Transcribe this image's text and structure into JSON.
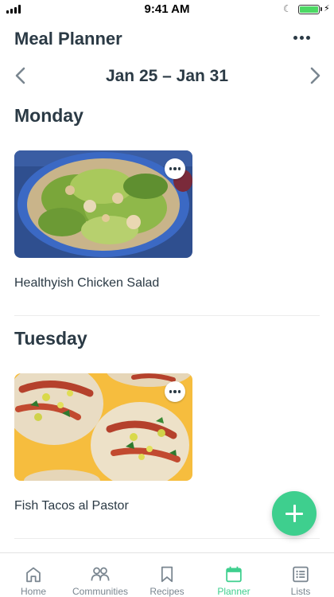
{
  "status_bar": {
    "time": "9:41 AM",
    "battery_level": 1.0
  },
  "header": {
    "title": "Meal Planner",
    "more_icon": "more-horizontal-icon"
  },
  "week": {
    "range": "Jan 25 – Jan 31",
    "prev_icon": "chevron-left-icon",
    "next_icon": "chevron-right-icon"
  },
  "days": [
    {
      "day": "Monday",
      "meal": {
        "title": "Healthyish Chicken Salad",
        "image": "chicken-salad-photo"
      }
    },
    {
      "day": "Tuesday",
      "meal": {
        "title": "Fish Tacos al Pastor",
        "image": "fish-tacos-photo"
      }
    }
  ],
  "fab": {
    "icon": "plus-icon"
  },
  "tabs": [
    {
      "label": "Home",
      "icon": "home-icon",
      "active": false
    },
    {
      "label": "Communities",
      "icon": "users-icon",
      "active": false
    },
    {
      "label": "Recipes",
      "icon": "bookmark-icon",
      "active": false
    },
    {
      "label": "Planner",
      "icon": "calendar-icon",
      "active": true
    },
    {
      "label": "Lists",
      "icon": "list-icon",
      "active": false
    }
  ],
  "colors": {
    "accent": "#3ecf8e",
    "text": "#2b3a45",
    "inactive": "#7a8690"
  }
}
